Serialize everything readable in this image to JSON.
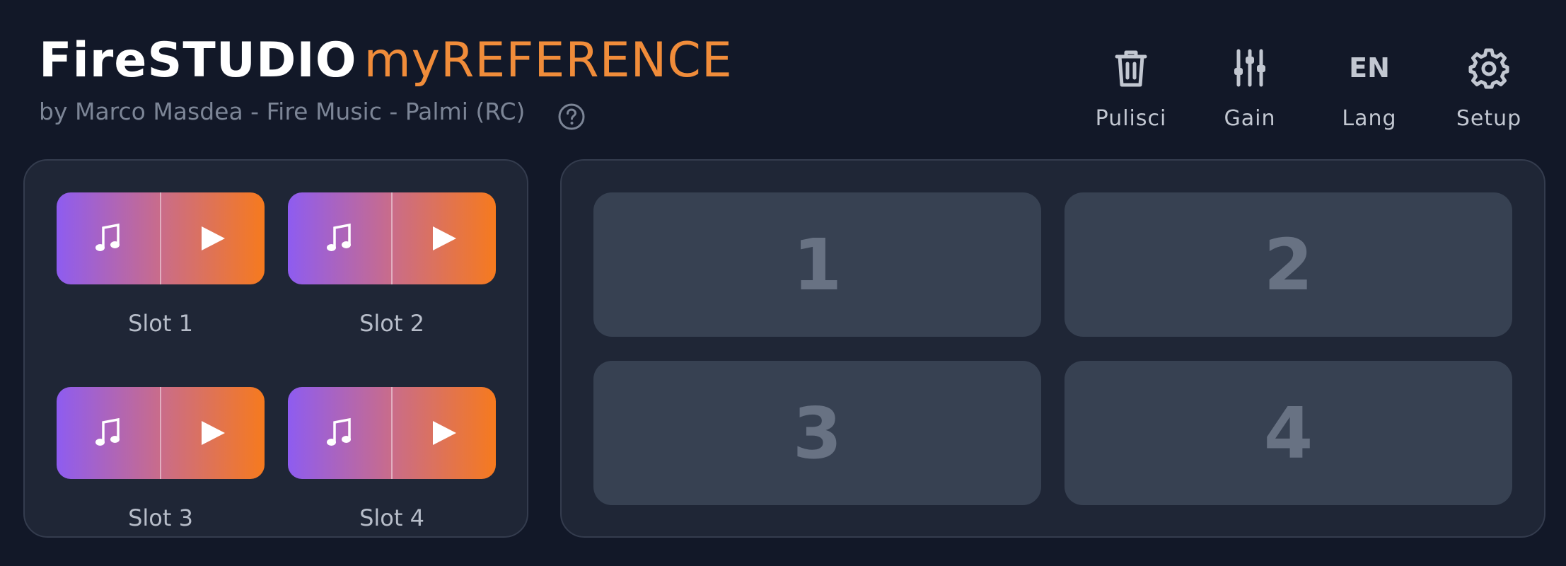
{
  "header": {
    "title_main": "FireSTUDIO",
    "title_accent": "myREFERENCE",
    "subtitle": "by Marco Masdea - Fire Music - Palmi (RC)"
  },
  "toolbar": {
    "clear": {
      "label": "Pulisci",
      "icon": "trash-icon"
    },
    "gain": {
      "label": "Gain",
      "icon": "sliders-icon"
    },
    "lang": {
      "label": "Lang",
      "code": "EN"
    },
    "setup": {
      "label": "Setup",
      "icon": "gear-icon"
    }
  },
  "slots": [
    {
      "label": "Slot 1"
    },
    {
      "label": "Slot 2"
    },
    {
      "label": "Slot 3"
    },
    {
      "label": "Slot 4"
    }
  ],
  "pads": [
    {
      "label": "1"
    },
    {
      "label": "2"
    },
    {
      "label": "3"
    },
    {
      "label": "4"
    }
  ],
  "colors": {
    "background": "#121828",
    "accent": "#f08c3a",
    "gradient_start": "#8e5cf0",
    "gradient_end": "#f67a1e",
    "pad": "#374152"
  }
}
